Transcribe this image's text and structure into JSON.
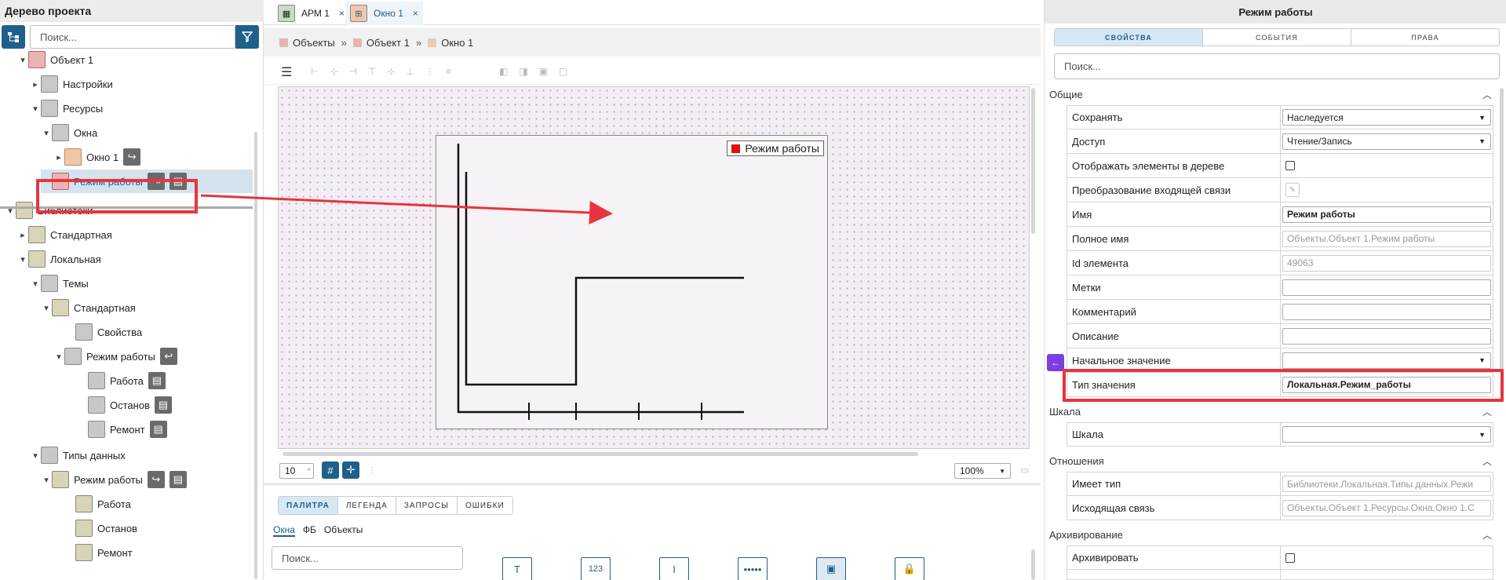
{
  "left_panel": {
    "title": "Дерево проекта",
    "search_placeholder": "Поиск...",
    "tree": [
      {
        "label": "Объект 1",
        "chev": "▾",
        "icon": "red"
      },
      {
        "label": "Настройки",
        "chev": "▸",
        "icon": "gray"
      },
      {
        "label": "Ресурсы",
        "chev": "▾",
        "icon": "gray"
      },
      {
        "label": "Окна",
        "chev": "▾",
        "icon": "gray"
      },
      {
        "label": "Окно 1",
        "chev": "▸",
        "icon": "orange"
      },
      {
        "label": "Режим работы",
        "chev": "",
        "icon": "red"
      },
      {
        "label": "Библиотеки",
        "chev": "▾",
        "icon": "olive"
      },
      {
        "label": "Стандартная",
        "chev": "▸",
        "icon": "olive"
      },
      {
        "label": "Локальная",
        "chev": "▾",
        "icon": "olive"
      },
      {
        "label": "Темы",
        "chev": "▾",
        "icon": "gray"
      },
      {
        "label": "Стандартная",
        "chev": "▾",
        "icon": "olive"
      },
      {
        "label": "Свойства",
        "chev": "",
        "icon": "gray"
      },
      {
        "label": "Режим работы",
        "chev": "▾",
        "icon": "gray"
      },
      {
        "label": "Работа",
        "chev": "",
        "icon": "gray"
      },
      {
        "label": "Останов",
        "chev": "",
        "icon": "gray"
      },
      {
        "label": "Ремонт",
        "chev": "",
        "icon": "gray"
      },
      {
        "label": "Типы данных",
        "chev": "▾",
        "icon": "gray"
      },
      {
        "label": "Режим работы",
        "chev": "▾",
        "icon": "olive"
      },
      {
        "label": "Работа",
        "chev": "",
        "icon": "olive"
      },
      {
        "label": "Останов",
        "chev": "",
        "icon": "olive"
      },
      {
        "label": "Ремонт",
        "chev": "",
        "icon": "olive"
      }
    ]
  },
  "tabs": [
    {
      "label": "АРМ 1",
      "close": "×"
    },
    {
      "label": "Окно 1",
      "close": "×"
    }
  ],
  "breadcrumb": [
    "Объекты",
    "Объект 1",
    "Окно 1"
  ],
  "breadcrumb_sep": "»",
  "trend": {
    "legend": "Режим работы"
  },
  "grid_step": "10",
  "zoom": "100%",
  "bottom_tabs": [
    "ПАЛИТРА",
    "ЛЕГЕНДА",
    "ЗАПРОСЫ",
    "ОШИБКИ"
  ],
  "sub_tabs": [
    "Окна",
    "ФБ",
    "Объекты"
  ],
  "palette_search_placeholder": "Поиск...",
  "right_panel": {
    "title": "Режим работы",
    "tabs": [
      "СВОЙСТВА",
      "СОБЫТИЯ",
      "ПРАВА"
    ],
    "search_placeholder": "Поиск...",
    "sections": {
      "general": "Общие",
      "scale": "Шкала",
      "relations": "Отношения",
      "archiving": "Архивирование"
    },
    "props": {
      "save": {
        "label": "Сохранять",
        "value": "Наследуется"
      },
      "access": {
        "label": "Доступ",
        "value": "Чтение/Запись"
      },
      "show_in_tree": {
        "label": "Отображать элементы в дереве"
      },
      "transform": {
        "label": "Преобразование входящей связи"
      },
      "name": {
        "label": "Имя",
        "value": "Режим работы"
      },
      "full_name": {
        "label": "Полное имя",
        "value": "Объекты.Объект 1.Режим работы"
      },
      "id": {
        "label": "Id элемента",
        "value": "49063"
      },
      "tags": {
        "label": "Метки",
        "value": ""
      },
      "comment": {
        "label": "Комментарий",
        "value": ""
      },
      "description": {
        "label": "Описание",
        "value": ""
      },
      "initial": {
        "label": "Начальное значение",
        "value": ""
      },
      "value_type": {
        "label": "Тип значения",
        "value": "Локальная.Режим_работы"
      },
      "scale": {
        "label": "Шкала",
        "value": ""
      },
      "has_type": {
        "label": "Имеет тип",
        "value": "Библиотеки.Локальная.Типы данных.Режи"
      },
      "outgoing": {
        "label": "Исходящая связь",
        "value": "Объекты.Объект 1.Ресурсы.Окна.Окно 1.С"
      },
      "archive": {
        "label": "Архивировать"
      }
    }
  },
  "colors": {
    "accent": "#1f5f8b",
    "highlight": "#e8343f",
    "legend_marker": "#e01010"
  }
}
